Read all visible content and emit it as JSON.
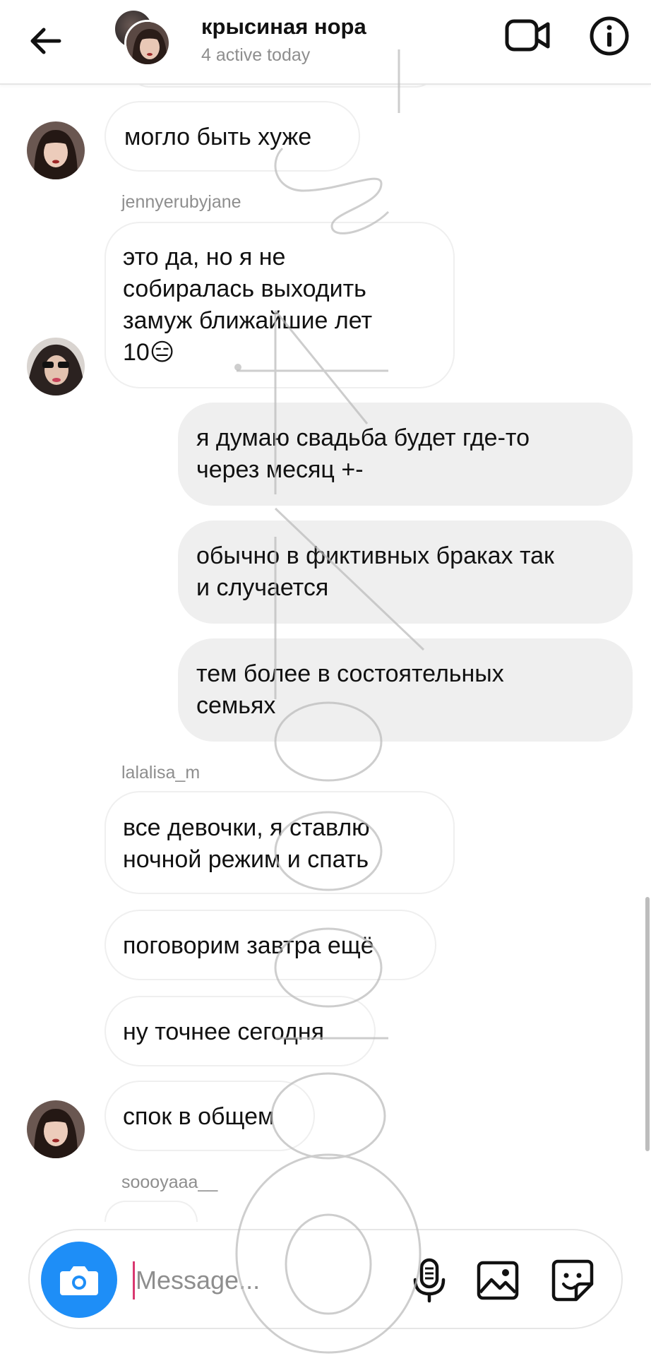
{
  "header": {
    "title": "крысиная нора",
    "status": "4 active today"
  },
  "messages": [
    {
      "id": "m1",
      "direction": "in",
      "text": "могло быть хуже"
    },
    {
      "id": "u1",
      "username": "jennyerubyjane"
    },
    {
      "id": "m2",
      "direction": "in",
      "lines": [
        "это да, но я не",
        "собиралась выходить",
        "замуж ближайшие лет",
        "10😑"
      ]
    },
    {
      "id": "m3",
      "direction": "out",
      "lines": [
        "я думаю свадьба будет где-то",
        "через месяц +-"
      ]
    },
    {
      "id": "m4",
      "direction": "out",
      "lines": [
        "обычно в фиктивных браках так",
        "и случается"
      ]
    },
    {
      "id": "m5",
      "direction": "out",
      "lines": [
        "тем более в состоятельных",
        "семьях"
      ]
    },
    {
      "id": "u2",
      "username": "lalalisa_m"
    },
    {
      "id": "m6",
      "direction": "in",
      "lines": [
        "все девочки, я ставлю",
        "ночной режим и спать"
      ]
    },
    {
      "id": "m7",
      "direction": "in",
      "text": "поговорим завтра ещё"
    },
    {
      "id": "m8",
      "direction": "in",
      "text": "ну точнее сегодня"
    },
    {
      "id": "m9",
      "direction": "in",
      "text": "спок в общем"
    },
    {
      "id": "u3",
      "username": "soooyaaa__"
    }
  ],
  "composer": {
    "placeholder": "Message..."
  },
  "icons": {
    "back": "arrow-left-icon",
    "video": "video-camera-icon",
    "info": "info-icon",
    "camera": "camera-icon",
    "mic": "microphone-icon",
    "gallery": "image-icon",
    "sticker": "sticker-icon"
  },
  "colors": {
    "accent": "#1e8ef7",
    "incoming_border": "#efefef",
    "outgoing_bg": "#efefef",
    "muted_text": "#8e8e8e"
  }
}
